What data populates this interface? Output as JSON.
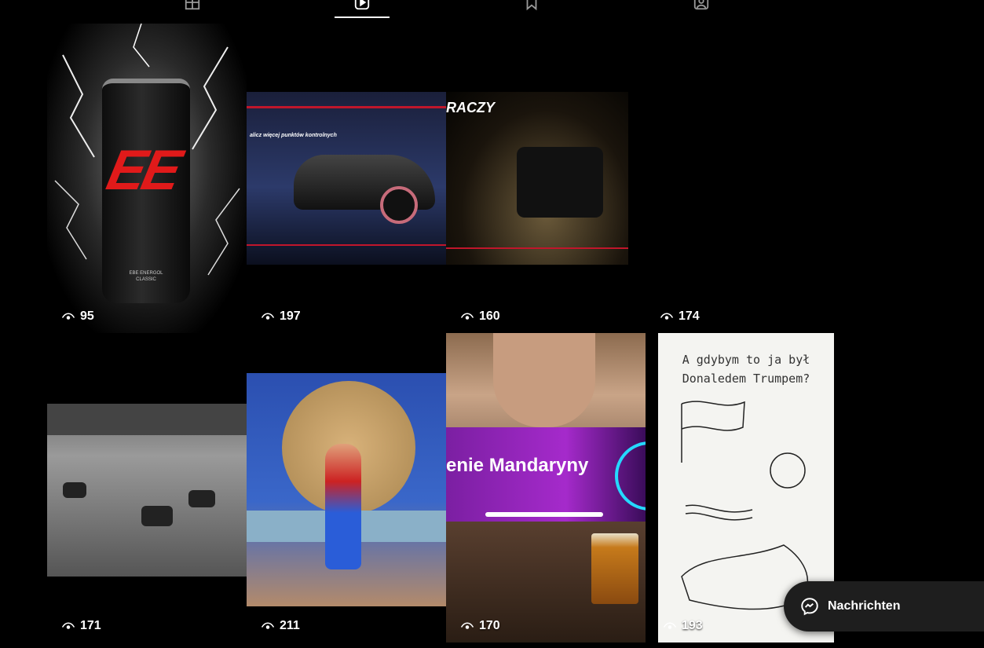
{
  "tabs": [
    {
      "icon": "grid-icon",
      "active": false
    },
    {
      "icon": "reels-icon",
      "active": true
    },
    {
      "icon": "bookmark-icon",
      "active": false
    },
    {
      "icon": "tagged-icon",
      "active": false
    }
  ],
  "posts": [
    {
      "views": "95",
      "title_lines": [
        "EBE ENERGOL",
        "CLASSIC"
      ],
      "can_logo": "EE"
    },
    {
      "views": "197",
      "overlay_text": "alicz więcej punktów kontrolnych"
    },
    {
      "views": "160",
      "overlay_text": "RACZY"
    },
    {
      "views": "174"
    },
    {
      "views": "171"
    },
    {
      "views": "211"
    },
    {
      "views": "170",
      "banner_text": "enie Mandaryny"
    },
    {
      "views": "193",
      "caption_lines": [
        "A gdybym to ja był",
        "Donaledem Trumpem?"
      ]
    }
  ],
  "messages_button": {
    "label": "Nachrichten"
  },
  "colors": {
    "accent_red": "#e01a1a",
    "banner_purple": "#7b1fa2",
    "banner_cyan": "#25d9ff"
  }
}
